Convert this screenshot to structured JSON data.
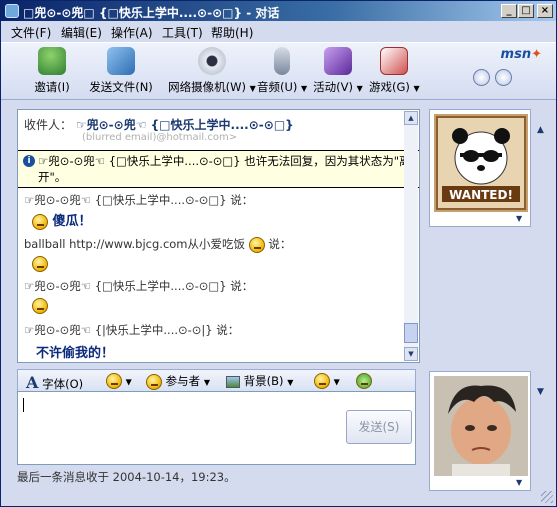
{
  "window": {
    "title": "□兜⊙-⊙兜□ {□快乐上学中....⊙-⊙□} - 对话",
    "controls": {
      "minimize": "_",
      "maximize": "□",
      "close": "×"
    }
  },
  "menu": [
    "文件(F)",
    "编辑(E)",
    "操作(A)",
    "工具(T)",
    "帮助(H)"
  ],
  "toolbar": {
    "items": [
      {
        "label": "邀请(I)",
        "icon": "invite-people-icon",
        "color": "#3a8a3a"
      },
      {
        "label": "发送文件(N)",
        "icon": "send-file-icon",
        "color": "#5a8ec8"
      },
      {
        "label": "网络摄像机(W)",
        "icon": "webcam-icon",
        "color": "#8a9ab0"
      },
      {
        "label": "音频(U)",
        "icon": "microphone-icon",
        "color": "#6a7a90"
      },
      {
        "label": "活动(V)",
        "icon": "activities-icon",
        "color": "#8a5ac0"
      },
      {
        "label": "游戏(G)",
        "icon": "games-icon",
        "color": "#c05050"
      }
    ],
    "brand": "msn"
  },
  "conversation": {
    "to_label": "收件人：",
    "to_name": "☞兜⊙-⊙兜☜ {□快乐上学中....⊙-⊙□}",
    "to_email": "(blurred email)@hotmail.com>",
    "notice": "☞兜⊙-⊙兜☜ {□快乐上学中....⊙-⊙□} 也许无法回复，因为其状态为\"离开\"。",
    "messages": [
      {
        "sender": "☞兜⊙-⊙兜☜ {□快乐上学中....⊙-⊙□} 说：",
        "body": "傻瓜！"
      },
      {
        "sender": "ballball http://www.bjcg.com从小爱吃饭",
        "says": "说：",
        "body": ""
      },
      {
        "sender": "☞兜⊙-⊙兜☜ {□快乐上学中....⊙-⊙□} 说：",
        "body": ""
      },
      {
        "sender": "☞兜⊙-⊙兜☜ {|快乐上学中....⊙-⊙|} 说：",
        "body": "不许偷我的！"
      }
    ]
  },
  "compose": {
    "toolbar": {
      "font": "字体(O)",
      "participants": "参与者",
      "background": "背景(B)"
    },
    "send_label": "发送(S)"
  },
  "status": "最后一条消息收于 2004-10-14，19:23。",
  "contact_avatar": {
    "caption": "WANTED!"
  }
}
